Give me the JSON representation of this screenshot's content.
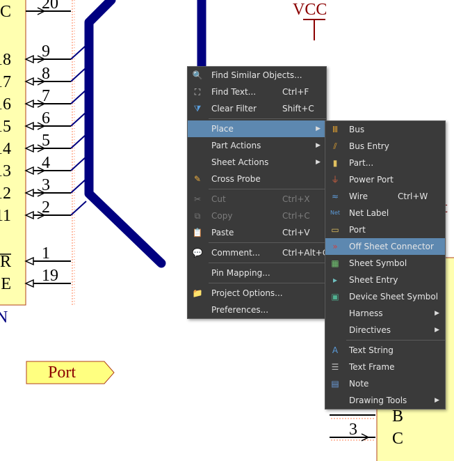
{
  "schematic": {
    "left_pins": [
      {
        "num": "20",
        "label": "C"
      },
      {
        "num": "9",
        "label": "18"
      },
      {
        "num": "8",
        "label": "17"
      },
      {
        "num": "7",
        "label": "16"
      },
      {
        "num": "6",
        "label": "15"
      },
      {
        "num": "5",
        "label": "14"
      },
      {
        "num": "4",
        "label": "13"
      },
      {
        "num": "3",
        "label": "12"
      },
      {
        "num": "2",
        "label": "11"
      },
      {
        "num": "1",
        "label": "R"
      },
      {
        "num": "19",
        "label": "E"
      }
    ],
    "component_footer": "N",
    "vcc_label": "VCC",
    "port_label": "Port",
    "right_fragment": "t",
    "right_pins": [
      {
        "num": "3",
        "label": "C"
      }
    ],
    "right_label_b": "B",
    "colors": {
      "component_fill": "#ffffb0",
      "component_border": "#b0401a",
      "bus": "#000080",
      "vcc": "#8b0000",
      "text": "#000000"
    }
  },
  "context_menu": {
    "items": [
      {
        "icon": "search-icon",
        "label": "Find Similar Objects...",
        "shortcut": "",
        "submenu": false,
        "enabled": true
      },
      {
        "icon": "binoculars-icon",
        "label": "Find Text...",
        "shortcut": "Ctrl+F",
        "submenu": false,
        "enabled": true
      },
      {
        "icon": "clear-filter-icon",
        "label": "Clear Filter",
        "shortcut": "Shift+C",
        "submenu": false,
        "enabled": true
      },
      {
        "sep": true
      },
      {
        "icon": "",
        "label": "Place",
        "shortcut": "",
        "submenu": true,
        "enabled": true,
        "highlighted": true
      },
      {
        "icon": "",
        "label": "Part Actions",
        "shortcut": "",
        "submenu": true,
        "enabled": true
      },
      {
        "icon": "",
        "label": "Sheet Actions",
        "shortcut": "",
        "submenu": true,
        "enabled": true
      },
      {
        "icon": "cross-probe-icon",
        "label": "Cross Probe",
        "shortcut": "",
        "submenu": false,
        "enabled": true
      },
      {
        "sep": true
      },
      {
        "icon": "cut-icon",
        "label": "Cut",
        "shortcut": "Ctrl+X",
        "submenu": false,
        "enabled": false
      },
      {
        "icon": "copy-icon",
        "label": "Copy",
        "shortcut": "Ctrl+C",
        "submenu": false,
        "enabled": false
      },
      {
        "icon": "paste-icon",
        "label": "Paste",
        "shortcut": "Ctrl+V",
        "submenu": false,
        "enabled": true
      },
      {
        "sep": true
      },
      {
        "icon": "comment-icon",
        "label": "Comment...",
        "shortcut": "Ctrl+Alt+C",
        "submenu": false,
        "enabled": true
      },
      {
        "sep": true
      },
      {
        "icon": "",
        "label": "Pin Mapping...",
        "shortcut": "",
        "submenu": false,
        "enabled": true
      },
      {
        "sep": true
      },
      {
        "icon": "folder-icon",
        "label": "Project Options...",
        "shortcut": "",
        "submenu": false,
        "enabled": true
      },
      {
        "icon": "",
        "label": "Preferences...",
        "shortcut": "",
        "submenu": false,
        "enabled": true
      }
    ]
  },
  "place_submenu": {
    "items": [
      {
        "icon": "bus-icon",
        "label": "Bus",
        "shortcut": "",
        "submenu": false
      },
      {
        "icon": "bus-entry-icon",
        "label": "Bus Entry",
        "shortcut": "",
        "submenu": false
      },
      {
        "icon": "part-icon",
        "label": "Part...",
        "shortcut": "",
        "submenu": false
      },
      {
        "icon": "power-port-icon",
        "label": "Power Port",
        "shortcut": "",
        "submenu": false
      },
      {
        "icon": "wire-icon",
        "label": "Wire",
        "shortcut": "Ctrl+W",
        "submenu": false
      },
      {
        "icon": "net-label-icon",
        "label": "Net Label",
        "shortcut": "",
        "submenu": false
      },
      {
        "icon": "port-icon",
        "label": "Port",
        "shortcut": "",
        "submenu": false
      },
      {
        "icon": "off-sheet-connector-icon",
        "label": "Off Sheet Connector",
        "shortcut": "",
        "submenu": false,
        "highlighted": true
      },
      {
        "icon": "sheet-symbol-icon",
        "label": "Sheet Symbol",
        "shortcut": "",
        "submenu": false
      },
      {
        "icon": "sheet-entry-icon",
        "label": "Sheet Entry",
        "shortcut": "",
        "submenu": false
      },
      {
        "icon": "device-sheet-symbol-icon",
        "label": "Device Sheet Symbol",
        "shortcut": "",
        "submenu": false
      },
      {
        "icon": "",
        "label": "Harness",
        "shortcut": "",
        "submenu": true
      },
      {
        "icon": "",
        "label": "Directives",
        "shortcut": "",
        "submenu": true
      },
      {
        "sep": true
      },
      {
        "icon": "text-string-icon",
        "label": "Text String",
        "shortcut": "",
        "submenu": false
      },
      {
        "icon": "text-frame-icon",
        "label": "Text Frame",
        "shortcut": "",
        "submenu": false
      },
      {
        "icon": "note-icon",
        "label": "Note",
        "shortcut": "",
        "submenu": false
      },
      {
        "icon": "",
        "label": "Drawing Tools",
        "shortcut": "",
        "submenu": true
      }
    ]
  }
}
